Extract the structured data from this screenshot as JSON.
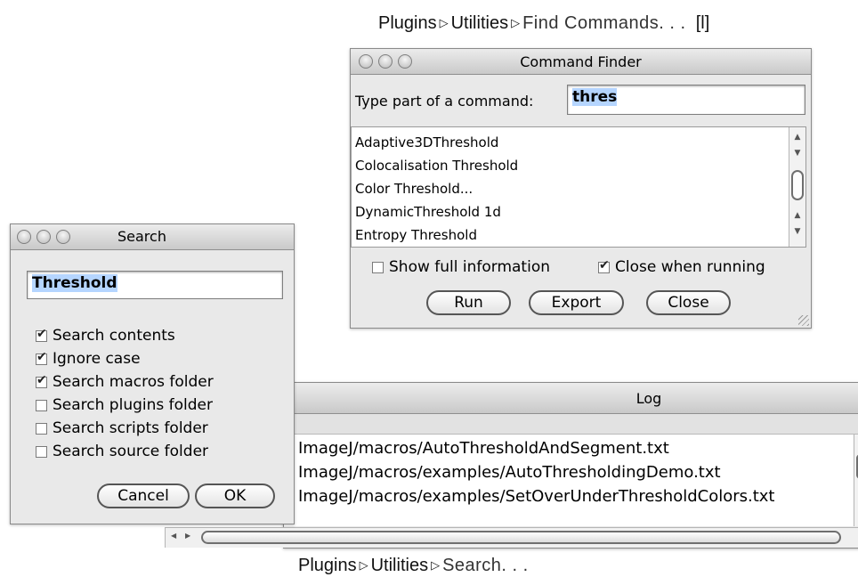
{
  "top_caption": {
    "p1": "Plugins",
    "sep1": "▷",
    "p2": "Utilities",
    "sep2": "▷",
    "p3": "Find Commands. . .",
    "shortcut": "[l]"
  },
  "bottom_caption": {
    "p1": "Plugins",
    "sep1": "▷",
    "p2": "Utilities",
    "sep2": "▷",
    "p3": "Search. . ."
  },
  "command_finder": {
    "title": "Command Finder",
    "prompt_label": "Type part of a command:",
    "input_value": "thres",
    "commands": [
      "Adaptive3DThreshold",
      "Colocalisation Threshold",
      "Color Threshold...",
      "DynamicThreshold 1d",
      "Entropy Threshold"
    ],
    "show_full_info": {
      "label": "Show full information",
      "checked": false
    },
    "close_when_running": {
      "label": "Close when running",
      "checked": true
    },
    "buttons": {
      "run": "Run",
      "export": "Export",
      "close": "Close"
    }
  },
  "search_dialog": {
    "title": "Search",
    "input_value": "Threshold",
    "options": [
      {
        "label": "Search contents",
        "checked": true
      },
      {
        "label": "Ignore case",
        "checked": true
      },
      {
        "label": "Search macros folder",
        "checked": true
      },
      {
        "label": "Search plugins folder",
        "checked": false
      },
      {
        "label": "Search scripts folder",
        "checked": false
      },
      {
        "label": "Search source folder",
        "checked": false
      }
    ],
    "buttons": {
      "cancel": "Cancel",
      "ok": "OK"
    }
  },
  "log_window": {
    "title": "Log",
    "lines": [
      "ImageJ/macros/AutoThresholdAndSegment.txt",
      "ImageJ/macros/examples/AutoThresholdingDemo.txt",
      "ImageJ/macros/examples/SetOverUnderThresholdColors.txt"
    ]
  },
  "icons": {
    "arrow_up": "▲",
    "arrow_down": "▼",
    "arrow_left": "◀",
    "arrow_right": "▶"
  }
}
